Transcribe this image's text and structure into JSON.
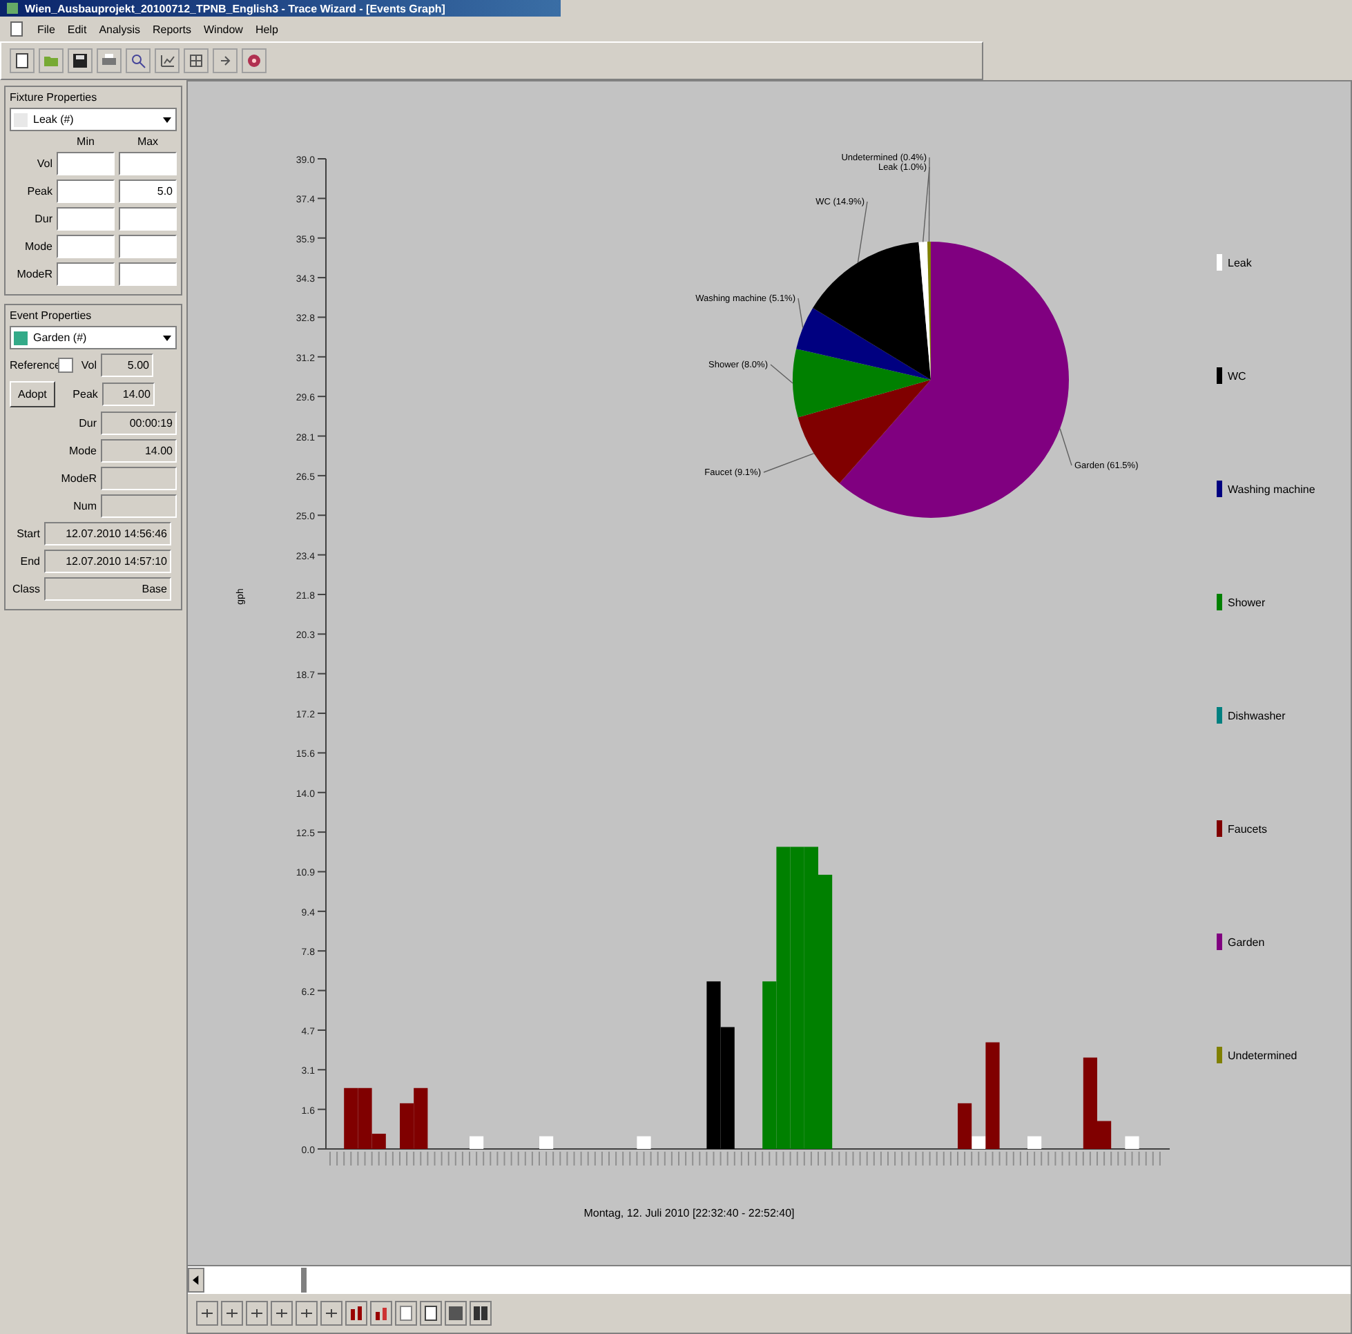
{
  "window": {
    "title": "Wien_Ausbauprojekt_20100712_TPNB_English3 - Trace Wizard - [Events Graph]"
  },
  "menu": [
    "File",
    "Edit",
    "Analysis",
    "Reports",
    "Window",
    "Help"
  ],
  "fixture_properties": {
    "title": "Fixture Properties",
    "selector": "Leak (#)",
    "columns": [
      "Min",
      "Max"
    ],
    "rows": [
      {
        "label": "Vol"
      },
      {
        "label": "Peak",
        "max": "5.0"
      },
      {
        "label": "Dur"
      },
      {
        "label": "Mode"
      },
      {
        "label": "ModeR"
      }
    ]
  },
  "event_properties": {
    "title": "Event Properties",
    "selector": "Garden (#)",
    "reference": {
      "label": "Reference",
      "checked": false
    },
    "adopt_button": "Adopt",
    "fields": [
      {
        "label": "Vol",
        "value": "5.00",
        "kind": "short"
      },
      {
        "label": "Peak",
        "value": "14.00",
        "kind": "short"
      },
      {
        "label": "Dur",
        "value": "00:00:19",
        "kind": "short"
      },
      {
        "label": "Mode",
        "value": "14.00",
        "kind": "short"
      },
      {
        "label": "ModeR",
        "kind": "short"
      },
      {
        "label": "Num",
        "kind": "short"
      },
      {
        "label": "Start",
        "value": "12.07.2010 14:56:46",
        "kind": "wide"
      },
      {
        "label": "End",
        "value": "12.07.2010 14:57:10",
        "kind": "wide"
      },
      {
        "label": "Class",
        "value": "Base",
        "kind": "wide"
      }
    ]
  },
  "bar_chart": {
    "chart_data": {
      "type": "bar",
      "xlabel": "Montag, 12. Juli 2010 [22:32:40 - 22:52:40]",
      "ylabel": "gph",
      "ylim": [
        0,
        39.0
      ],
      "yticks": [
        {
          "value": 0,
          "label": "0.0"
        },
        {
          "value": 1.56,
          "label": "1.6"
        },
        {
          "value": 3.12,
          "label": "3.1"
        },
        {
          "value": 4.68,
          "label": "4.7"
        },
        {
          "value": 6.24,
          "label": "6.2"
        },
        {
          "value": 7.8,
          "label": "7.8"
        },
        {
          "value": 9.36,
          "label": "9.4"
        },
        {
          "value": 10.92,
          "label": "10.9"
        },
        {
          "value": 12.48,
          "label": "12.5"
        },
        {
          "value": 14.04,
          "label": "14.0"
        },
        {
          "value": 15.6,
          "label": "15.6"
        },
        {
          "value": 17.16,
          "label": "17.2"
        },
        {
          "value": 18.72,
          "label": "18.7"
        },
        {
          "value": 20.28,
          "label": "20.3"
        },
        {
          "value": 21.84,
          "label": "21.8"
        },
        {
          "value": 23.4,
          "label": "23.4"
        },
        {
          "value": 24.96,
          "label": "25.0"
        },
        {
          "value": 26.52,
          "label": "26.5"
        },
        {
          "value": 28.08,
          "label": "28.1"
        },
        {
          "value": 29.64,
          "label": "29.6"
        },
        {
          "value": 31.2,
          "label": "31.2"
        },
        {
          "value": 32.76,
          "label": "32.8"
        },
        {
          "value": 34.32,
          "label": "34.3"
        },
        {
          "value": 35.88,
          "label": "35.9"
        },
        {
          "value": 37.44,
          "label": "37.4"
        },
        {
          "value": 39.0,
          "label": "39.0"
        }
      ],
      "series": [
        {
          "name": "Leak",
          "color": "#ffffff",
          "values": [
            null,
            null,
            null,
            null,
            null,
            null,
            null,
            null,
            null,
            null,
            0.5,
            null,
            null,
            null,
            null,
            0.5,
            null,
            null,
            null,
            null,
            null,
            null,
            0.5,
            null,
            null,
            null,
            null,
            null,
            null,
            null,
            null,
            null,
            null,
            null,
            null,
            null,
            null,
            null,
            null,
            null,
            null,
            null,
            null,
            null,
            null,
            null,
            0.5,
            null,
            null,
            null,
            0.5,
            null,
            null,
            null,
            null,
            null,
            null,
            0.5,
            null,
            null
          ]
        },
        {
          "name": "WC",
          "color": "#000000",
          "values": [
            null,
            null,
            null,
            null,
            null,
            null,
            null,
            null,
            null,
            null,
            null,
            null,
            null,
            null,
            null,
            null,
            null,
            null,
            null,
            null,
            null,
            null,
            null,
            null,
            null,
            null,
            null,
            6.6,
            4.8,
            null,
            null,
            null,
            null,
            null,
            null,
            null,
            null,
            null,
            null,
            null,
            null,
            null,
            null,
            null,
            null,
            null,
            null,
            null,
            null,
            null,
            null,
            null,
            null,
            null,
            null,
            null,
            null,
            null,
            null,
            null
          ]
        },
        {
          "name": "Washing machine",
          "color": "#000080",
          "values": [
            null,
            null,
            null,
            null,
            null,
            null,
            null,
            null,
            null,
            null,
            null,
            null,
            null,
            null,
            null,
            null,
            null,
            null,
            null,
            null,
            null,
            null,
            null,
            null,
            null,
            null,
            null,
            null,
            null,
            null,
            null,
            null,
            null,
            null,
            null,
            null,
            null,
            null,
            null,
            null,
            null,
            null,
            null,
            null,
            null,
            null,
            null,
            null,
            null,
            null,
            null,
            null,
            null,
            null,
            null,
            null,
            null,
            null,
            null,
            null
          ]
        },
        {
          "name": "Shower",
          "color": "#008000",
          "values": [
            null,
            null,
            null,
            null,
            null,
            null,
            null,
            null,
            null,
            null,
            null,
            null,
            null,
            null,
            null,
            null,
            null,
            null,
            null,
            null,
            null,
            null,
            null,
            null,
            null,
            null,
            null,
            null,
            null,
            null,
            null,
            6.6,
            11.9,
            11.9,
            11.9,
            10.8,
            null,
            null,
            null,
            null,
            null,
            null,
            null,
            null,
            null,
            null,
            null,
            null,
            null,
            null,
            null,
            null,
            null,
            null,
            null,
            null,
            null,
            null,
            null,
            null
          ]
        },
        {
          "name": "Dishwasher",
          "color": "#008080",
          "values": [
            null,
            null,
            null,
            null,
            null,
            null,
            null,
            null,
            null,
            null,
            null,
            null,
            null,
            null,
            null,
            null,
            null,
            null,
            null,
            null,
            null,
            null,
            null,
            null,
            null,
            null,
            null,
            null,
            null,
            null,
            null,
            null,
            null,
            null,
            null,
            null,
            null,
            null,
            null,
            null,
            null,
            null,
            null,
            null,
            null,
            null,
            null,
            null,
            null,
            null,
            null,
            null,
            null,
            null,
            null,
            null,
            null,
            null,
            null,
            null
          ]
        },
        {
          "name": "Faucets",
          "color": "#800000",
          "values": [
            null,
            2.4,
            2.4,
            0.6,
            null,
            1.8,
            2.4,
            null,
            null,
            null,
            null,
            null,
            null,
            null,
            null,
            null,
            null,
            null,
            null,
            null,
            null,
            null,
            null,
            null,
            null,
            null,
            null,
            null,
            null,
            null,
            null,
            null,
            null,
            null,
            null,
            null,
            null,
            null,
            null,
            null,
            null,
            null,
            null,
            null,
            null,
            1.8,
            null,
            4.2,
            null,
            null,
            null,
            null,
            null,
            null,
            3.6,
            1.1,
            null,
            null,
            null,
            null
          ]
        },
        {
          "name": "Garden",
          "color": "#800080",
          "values": [
            null,
            null,
            null,
            null,
            null,
            null,
            null,
            null,
            null,
            null,
            null,
            null,
            null,
            null,
            null,
            null,
            null,
            null,
            null,
            null,
            null,
            null,
            null,
            null,
            null,
            null,
            null,
            null,
            null,
            null,
            null,
            null,
            null,
            null,
            null,
            null,
            null,
            null,
            null,
            null,
            null,
            null,
            null,
            null,
            null,
            null,
            null,
            null,
            null,
            null,
            null,
            null,
            null,
            null,
            null,
            null,
            null,
            null,
            null,
            null
          ]
        },
        {
          "name": "Undetermined",
          "color": "#808000",
          "values": [
            null,
            null,
            null,
            null,
            null,
            null,
            null,
            null,
            null,
            null,
            null,
            null,
            null,
            null,
            null,
            null,
            null,
            null,
            null,
            null,
            null,
            null,
            null,
            null,
            null,
            null,
            null,
            null,
            null,
            null,
            null,
            null,
            null,
            null,
            null,
            null,
            null,
            null,
            null,
            null,
            null,
            null,
            null,
            null,
            null,
            null,
            null,
            null,
            null,
            null,
            null,
            null,
            null,
            null,
            null,
            null,
            null,
            null,
            null,
            null
          ]
        }
      ]
    }
  },
  "pie_chart": {
    "chart_data": {
      "type": "pie",
      "categories": [
        "Garden (61.5%)",
        "Faucet (9.1%)",
        "Shower (8.0%)",
        "Washing machine (5.1%)",
        "WC (14.9%)",
        "Leak (1.0%)",
        "Undetermined (0.4%)"
      ],
      "values": [
        61.5,
        9.1,
        8.0,
        5.1,
        14.9,
        1.0,
        0.4
      ],
      "colors": [
        "#800080",
        "#800000",
        "#008000",
        "#000080",
        "#000000",
        "#ffffff",
        "#808000"
      ]
    }
  }
}
